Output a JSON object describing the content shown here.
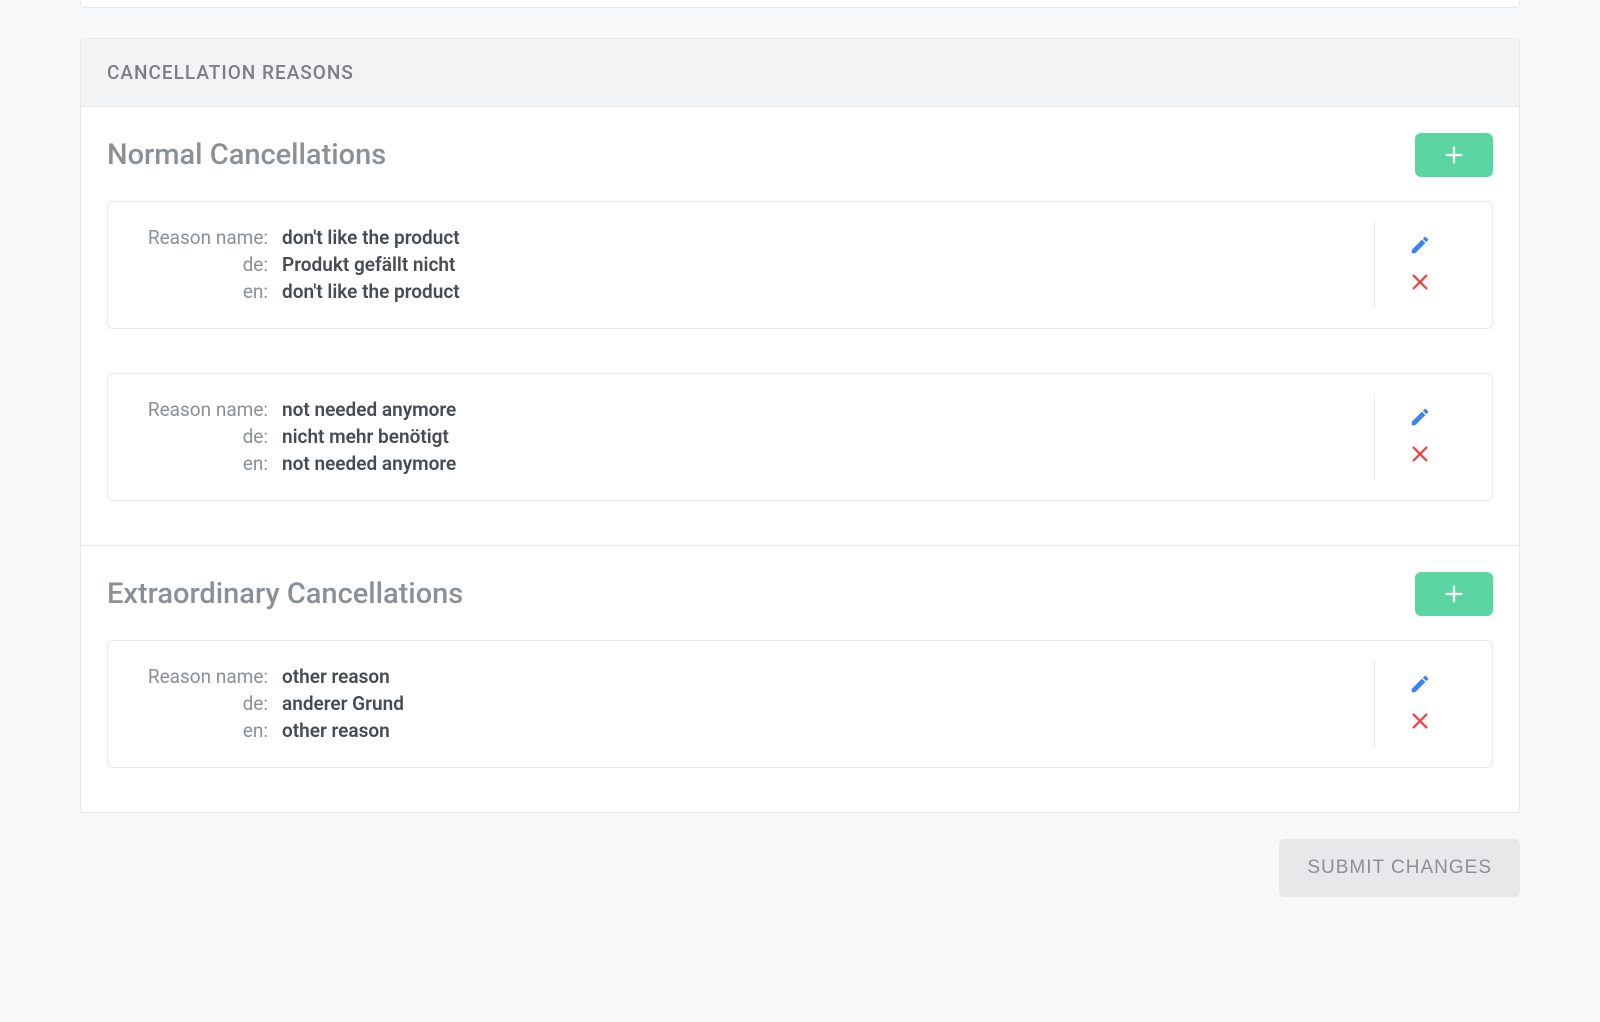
{
  "header": {
    "title": "CANCELLATION REASONS"
  },
  "labels": {
    "reason_name": "Reason name:",
    "de": "de:",
    "en": "en:"
  },
  "sections": {
    "normal": {
      "heading": "Normal Cancellations",
      "items": [
        {
          "name": "don't like the product",
          "de": "Produkt gefällt nicht",
          "en": "don't like the product"
        },
        {
          "name": "not needed anymore",
          "de": "nicht mehr benötigt",
          "en": "not needed anymore"
        }
      ]
    },
    "extraordinary": {
      "heading": "Extraordinary Cancellations",
      "items": [
        {
          "name": "other reason",
          "de": "anderer Grund",
          "en": "other reason"
        }
      ]
    }
  },
  "footer": {
    "submit_label": "SUBMIT CHANGES"
  },
  "colors": {
    "accent_green": "#5bd6a2",
    "edit_blue": "#3b82f6",
    "delete_red": "#ef4444",
    "muted_text": "#8b9096"
  }
}
